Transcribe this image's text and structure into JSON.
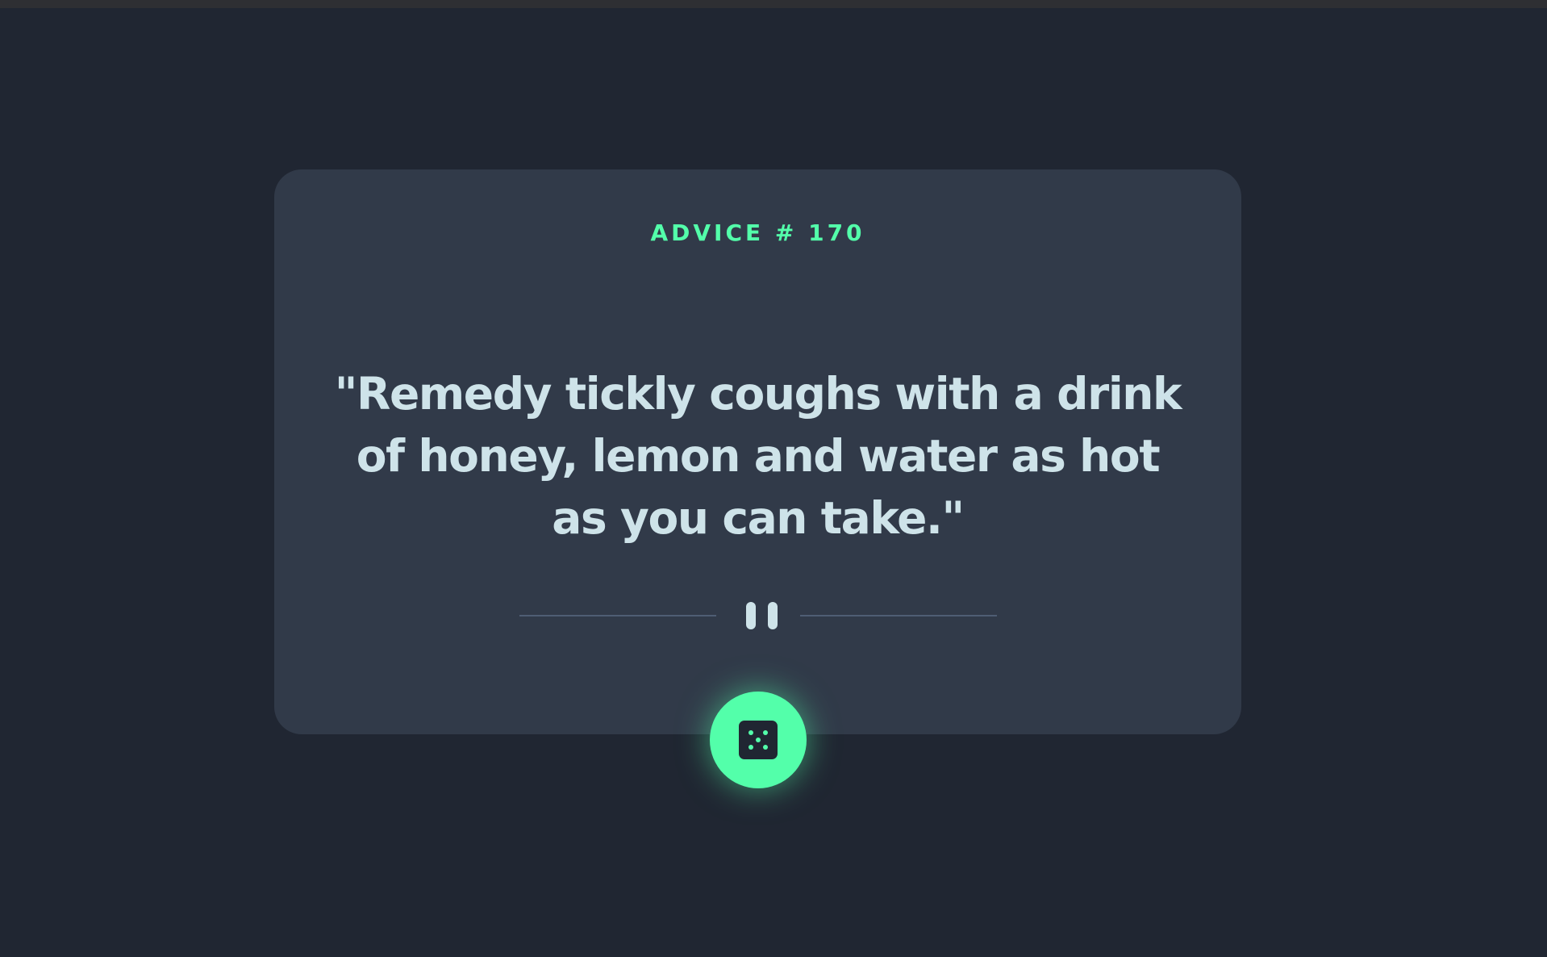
{
  "advice": {
    "id_label": "ADVICE # 170",
    "quote": "\"Remedy tickly coughs with a drink of honey, lemon and water as hot as you can take.\""
  },
  "colors": {
    "background": "#202632",
    "card": "#313a49",
    "accent": "#53ffaa",
    "text": "#cee3e9",
    "divider": "#4f5d74"
  },
  "icons": {
    "divider": "pause-icon",
    "button": "dice-icon"
  }
}
